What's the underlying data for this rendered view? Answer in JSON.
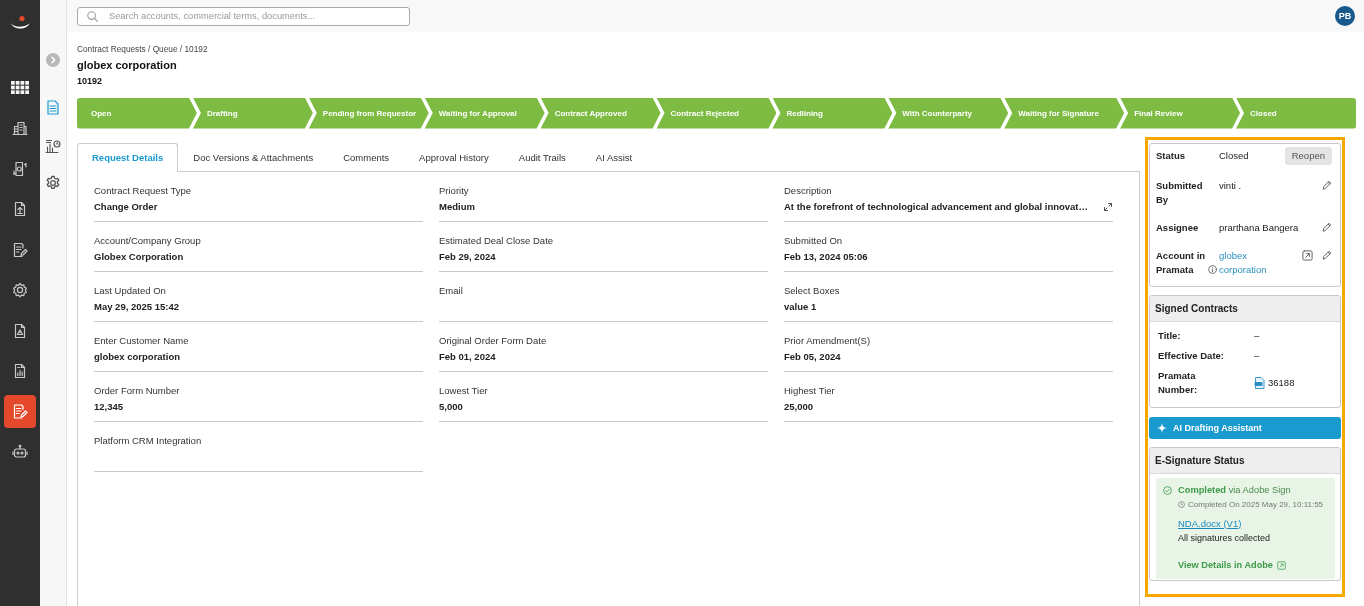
{
  "nav_rail": {
    "items": [
      {
        "selected": false
      },
      {
        "selected": false
      },
      {
        "selected": false
      },
      {
        "selected": false
      },
      {
        "selected": false
      },
      {
        "selected": false
      },
      {
        "selected": false
      },
      {
        "selected": false
      },
      {
        "selected": true
      },
      {
        "selected": false
      }
    ]
  },
  "sub_rail": {
    "items": [
      {
        "selected": true
      },
      {
        "selected": false
      },
      {
        "selected": false
      }
    ]
  },
  "top_bar": {
    "search": {
      "placeholder": "Search accounts, commercial terms, documents..."
    },
    "avatar": {
      "initials": "PB"
    }
  },
  "header": {
    "breadcrumb": "Contract Requests / Queue / 10192",
    "title": "globex corporation",
    "subtitle": "10192"
  },
  "pipeline": {
    "stages": [
      {
        "label": "Open"
      },
      {
        "label": "Drafting"
      },
      {
        "label": "Pending from Requestor"
      },
      {
        "label": "Waiting for Approval"
      },
      {
        "label": "Contract Approved"
      },
      {
        "label": "Contract Rejected"
      },
      {
        "label": "Redlining"
      },
      {
        "label": "With Counterparty"
      },
      {
        "label": "Waiting for Signature"
      },
      {
        "label": "Final Review"
      },
      {
        "label": "Closed"
      }
    ]
  },
  "tabs": [
    {
      "label": "Request Details",
      "selected": true
    },
    {
      "label": "Doc Versions & Attachments",
      "selected": false
    },
    {
      "label": "Comments",
      "selected": false
    },
    {
      "label": "Approval History",
      "selected": false
    },
    {
      "label": "Audit Trails",
      "selected": false
    },
    {
      "label": "AI Assist",
      "selected": false
    }
  ],
  "details": {
    "columns": [
      {
        "fields": [
          {
            "label": "Contract Request Type",
            "value": "Change Order",
            "expandable": false
          },
          {
            "label": "Account/Company Group",
            "value": "Globex Corporation",
            "expandable": false
          },
          {
            "label": "Last Updated On",
            "value": "May 29, 2025 15:42",
            "expandable": false
          },
          {
            "label": "Enter Customer Name",
            "value": "globex corporation",
            "expandable": false
          },
          {
            "label": "Order Form Number",
            "value": "12,345",
            "expandable": false
          },
          {
            "label": "Platform CRM Integration",
            "expandable": false
          }
        ]
      },
      {
        "fields": [
          {
            "label": "Priority",
            "value": "Medium",
            "expandable": false
          },
          {
            "label": "Estimated Deal Close Date",
            "value": "Feb 29, 2024",
            "expandable": false
          },
          {
            "label": "Email",
            "expandable": false
          },
          {
            "label": "Original Order Form Date",
            "value": "Feb 01, 2024",
            "expandable": false
          },
          {
            "label": "Lowest Tier",
            "value": "5,000",
            "expandable": false
          }
        ]
      },
      {
        "fields": [
          {
            "label": "Description",
            "value": "At the forefront of technological advancement and global innovat…",
            "expandable": true
          },
          {
            "label": "Submitted On",
            "value": "Feb 13, 2024 05:06",
            "expandable": false
          },
          {
            "label": "Select Boxes",
            "value": "value 1",
            "expandable": false
          },
          {
            "label": "Prior Amendment(S)",
            "value": "Feb 05, 2024",
            "expandable": false
          },
          {
            "label": "Highest Tier",
            "value": "25,000",
            "expandable": false
          }
        ]
      }
    ]
  },
  "summary": {
    "rows": [
      {
        "kind": "status",
        "label": "Status",
        "value": "Closed",
        "button": "Reopen",
        "info": false,
        "editable": false
      },
      {
        "kind": "text",
        "label": "Submitted By",
        "value": "vinti .",
        "info": false,
        "editable": true
      },
      {
        "kind": "text",
        "label": "Assignee",
        "value": "prarthana Bangera",
        "info": false,
        "editable": true
      },
      {
        "kind": "link",
        "label": "Account in Pramata",
        "value": "globex corporation",
        "info": true,
        "editable": true
      }
    ]
  },
  "signed_contracts": {
    "title": "Signed Contracts",
    "rows": [
      {
        "kind": "text",
        "label": "Title:",
        "value": "–"
      },
      {
        "kind": "text",
        "label": "Effective Date:",
        "value": "–"
      },
      {
        "kind": "file",
        "label": "Pramata Number:",
        "value": "36188"
      }
    ]
  },
  "ai_button": {
    "label": "AI Drafting Assistant"
  },
  "esignature": {
    "title": "E-Signature Status",
    "status": "**Completed** via Adobe Sign",
    "completed_on": "Completed On 2025 May 29, 10:11:55",
    "document": "NDA.docx (V1)",
    "note": "All signatures collected",
    "details_link": "View Details in Adobe"
  }
}
